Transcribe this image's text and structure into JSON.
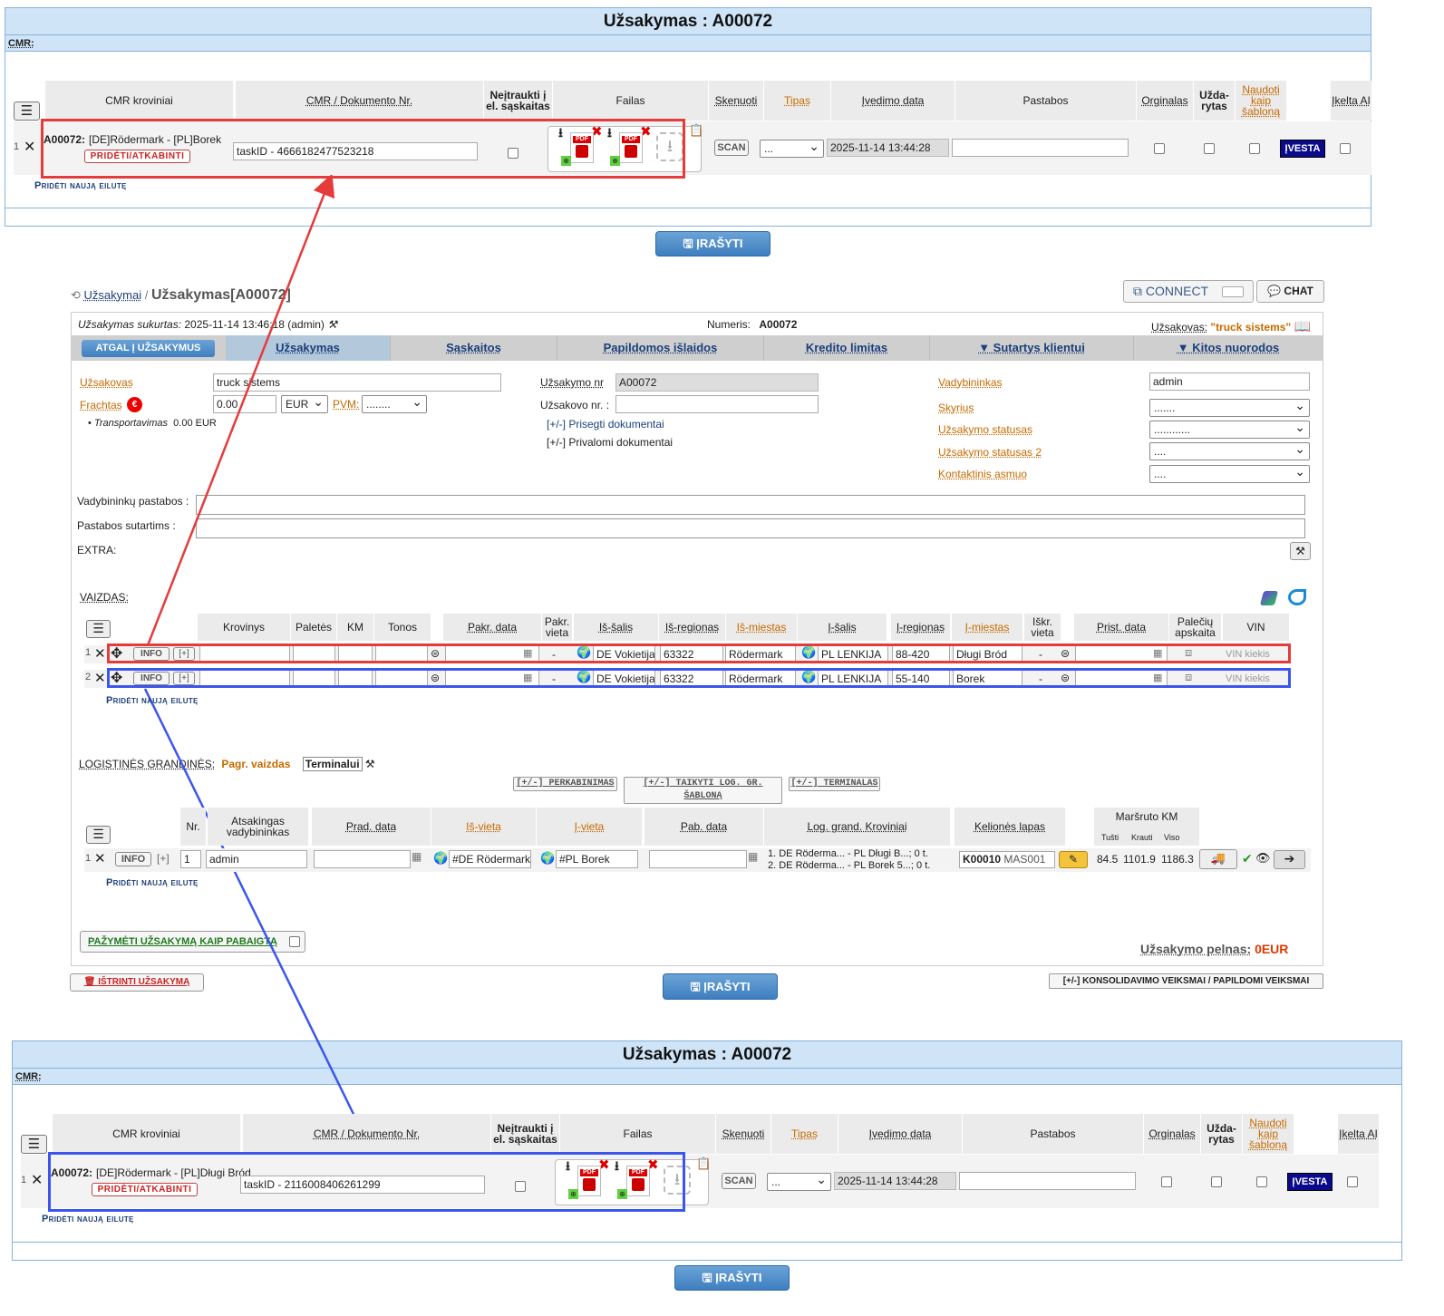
{
  "top_panel": {
    "title": "Užsakymas : A00072",
    "sub": "CMR:",
    "headers": {
      "cmr_kroviniai": "CMR kroviniai",
      "cmr_doc": "CMR / Dokumento Nr.",
      "neitraukti": "Neįtraukti į el. sąskaitas",
      "failas": "Failas",
      "skenuoti": "Skenuoti",
      "tipas": "Tipas",
      "ivedimo_data": "Įvedimo data",
      "pastabos": "Pastabos",
      "orginalas": "Orginalas",
      "uzdarytas": "Užda-rytas",
      "naudoti": "Naudoti kaip šabloną",
      "ikelta": "Įkelta AI"
    },
    "row": {
      "num": "1",
      "order": "A00072:",
      "route": "[DE]Rödermark - [PL]Borek",
      "attach": "PRIDĖTI/ATKABINTI",
      "doc_value": "taskID - 4666182477523218",
      "scan": "SCAN",
      "tipas": "...",
      "date": "2025-11-14 13:44:28",
      "ivesta": "ĮVESTA"
    },
    "add_row": "Pridėti naują eilutę",
    "save": "ĮRAŠYTI"
  },
  "breadcrumb": {
    "link": "Užsakymai",
    "sep": "/",
    "current": "Užsakymas[A00072]"
  },
  "connect": "CONNECT",
  "chat": "CHAT",
  "info_bar": {
    "created_label": "Užsakymas sukurtas:",
    "created_value": "2025-11-14 13:46:18 (admin)",
    "numeris_label": "Numeris:",
    "numeris_value": "A00072",
    "uzsakovas_label": "Užsakovas:",
    "uzsakovas_value": "\"truck sistems\""
  },
  "tabs": {
    "back": "ATGAL Į UŽSAKYMUS",
    "items": [
      "Užsakymas",
      "Sąskaitos",
      "Papildomos išlaidos",
      "Kredito limitas",
      "▼ Sutartys klientui",
      "▼ Kitos nuorodos"
    ]
  },
  "form": {
    "uzsakovas_label": "Užsakovas",
    "uzsakovas_value": "truck sistems",
    "frachtas_label": "Frachtas",
    "frachtas_value": "0.00",
    "currency": "EUR",
    "pvm_label": "PVM:",
    "pvm_value": "........",
    "transport_label": "Transportavimas",
    "transport_value": "0.00 EUR",
    "uzsakymo_nr_label": "Užsakymo nr",
    "uzsakymo_nr_value": "A00072",
    "uzsakovo_nr_label": "Užsakovo nr. :",
    "prisegti": "[+/-] Prisegti dokumentai",
    "privalomi": "[+/-] Privalomi dokumentai",
    "vadybininkas_label": "Vadybininkas",
    "vadybininkas_value": "admin",
    "skyrius_label": "Skyrius",
    "skyrius_value": ".......",
    "statusas_label": "Užsakymo statusas",
    "statusas_value": "............",
    "statusas2_label": "Užsakymo statusas 2",
    "statusas2_value": "....",
    "kontaktinis_label": "Kontaktinis asmuo",
    "kontaktinis_value": "....",
    "vad_pastabos_label": "Vadybininkų pastabos :",
    "pastabos_sut_label": "Pastabos sutartims :",
    "extra_label": "EXTRA:"
  },
  "vaizdas": {
    "label": "VAIZDAS:",
    "headers": [
      "Krovinys",
      "Paletės",
      "KM",
      "Tonos",
      "Pakr. data",
      "Pakr. vieta",
      "Iš-šalis",
      "Iš-regionas",
      "Iš-miestas",
      "Į-šalis",
      "Į-regionas",
      "Į-miestas",
      "Iškr. vieta",
      "Prist. data",
      "Palečių apskaita",
      "VIN"
    ],
    "rows": [
      {
        "num": "1",
        "info": "INFO",
        "plus": "[+]",
        "dash": "-",
        "is_salis": "DE Vokietija",
        "is_regionas": "63322",
        "is_miestas": "Rödermark",
        "i_salis": "PL LENKIJA",
        "i_regionas": "88-420",
        "i_miestas": "Długi Bród",
        "dash2": "-",
        "vin": "VIN kiekis"
      },
      {
        "num": "2",
        "info": "INFO",
        "plus": "[+]",
        "dash": "-",
        "is_salis": "DE Vokietija",
        "is_regionas": "63322",
        "is_miestas": "Rödermark",
        "i_salis": "PL LENKIJA",
        "i_regionas": "55-140",
        "i_miestas": "Borek",
        "dash2": "-",
        "vin": "VIN kiekis"
      }
    ],
    "add_row": "Pridėti naują eilutę"
  },
  "logistines": {
    "label": "LOGISTINĖS GRANDINĖS:",
    "pagr": "Pagr. vaizdas",
    "terminalui": "Terminalui",
    "btn1": "[+/-] PERKABINIMAS",
    "btn2": "[+/-] TAIKYTI LOG. GR. ŠABLONĄ",
    "btn3": "[+/-] TERMINALAS",
    "headers": {
      "nr": "Nr.",
      "atsakingas": "Atsakingas vadybininkas",
      "prad": "Prad. data",
      "isvieta": "Iš-vieta",
      "ivieta": "Į-vieta",
      "pab": "Pab. data",
      "krov": "Log. grand. Kroviniai",
      "kelionės": "Kelionės lapas",
      "marsrutas": "Maršruto KM",
      "tusti": "Tušti",
      "krauti": "Krauti",
      "viso": "Viso"
    },
    "row": {
      "num": "1",
      "info": "INFO",
      "plus": "[+]",
      "nr": "1",
      "atsakingas": "admin",
      "isvieta": "#DE Rödermark",
      "ivieta": "#PL Borek",
      "krov1": "1. DE Röderma... - PL Długi B...; 0 t.",
      "krov2": "2. DE Röderma... - PL Borek 5...; 0 t.",
      "kel1": "K00010",
      "kel2": "MAS001",
      "tusti": "84.5",
      "krauti": "1101.9",
      "viso": "1186.3"
    },
    "add_row": "Pridėti naują eilutę"
  },
  "pazymeti": "PAŽYMĖTI UŽSAKYMĄ KAIP PABAIGTĄ",
  "pelnas_label": "Užsakymo pelnas:",
  "pelnas_value": "0EUR",
  "istrinti": "IŠTRINTI UŽSAKYMĄ",
  "save": "ĮRAŠYTI",
  "konsol": "[+/-] KONSOLIDAVIMO VEIKSMAI / PAPILDOMI VEIKSMAI",
  "bottom_panel": {
    "title": "Užsakymas : A00072",
    "sub": "CMR:",
    "row": {
      "num": "1",
      "order": "A00072:",
      "route": "[DE]Rödermark - [PL]Długi Bród",
      "attach": "PRIDĖTI/ATKABINTI",
      "doc_value": "taskID - 2116008406261299",
      "scan": "SCAN",
      "tipas": "...",
      "date": "2025-11-14 13:44:28",
      "ivesta": "ĮVESTA"
    },
    "add_row": "Pridėti naują eilutę",
    "save": "ĮRAŠYTI"
  },
  "colors": {
    "red_highlight": "#e53b3b",
    "blue_highlight": "#3b55f0",
    "accent": "#c66a00",
    "link": "#1b3f7a"
  }
}
